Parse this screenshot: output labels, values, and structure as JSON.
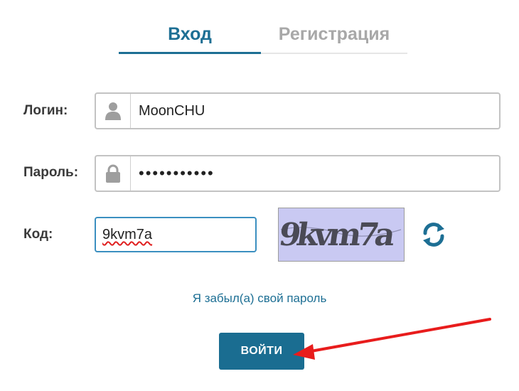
{
  "tabs": {
    "login": "Вход",
    "register": "Регистрация"
  },
  "form": {
    "login_label": "Логин:",
    "login_value": "MoonCHU",
    "password_label": "Пароль:",
    "password_value": "•••••••••••",
    "code_label": "Код:",
    "code_value": "9kvm7a",
    "captcha_text": "9kvm7a"
  },
  "links": {
    "forgot_password": "Я забыл(а) свой пароль"
  },
  "buttons": {
    "submit": "ВОЙТИ"
  },
  "icons": {
    "user": "user-icon",
    "lock": "lock-icon",
    "refresh": "refresh-icon"
  },
  "colors": {
    "accent": "#1d6f94",
    "inactive_tab": "#a8a8a8",
    "captcha_bg": "#c9c9f2",
    "annotation_arrow": "#e81c1c"
  }
}
